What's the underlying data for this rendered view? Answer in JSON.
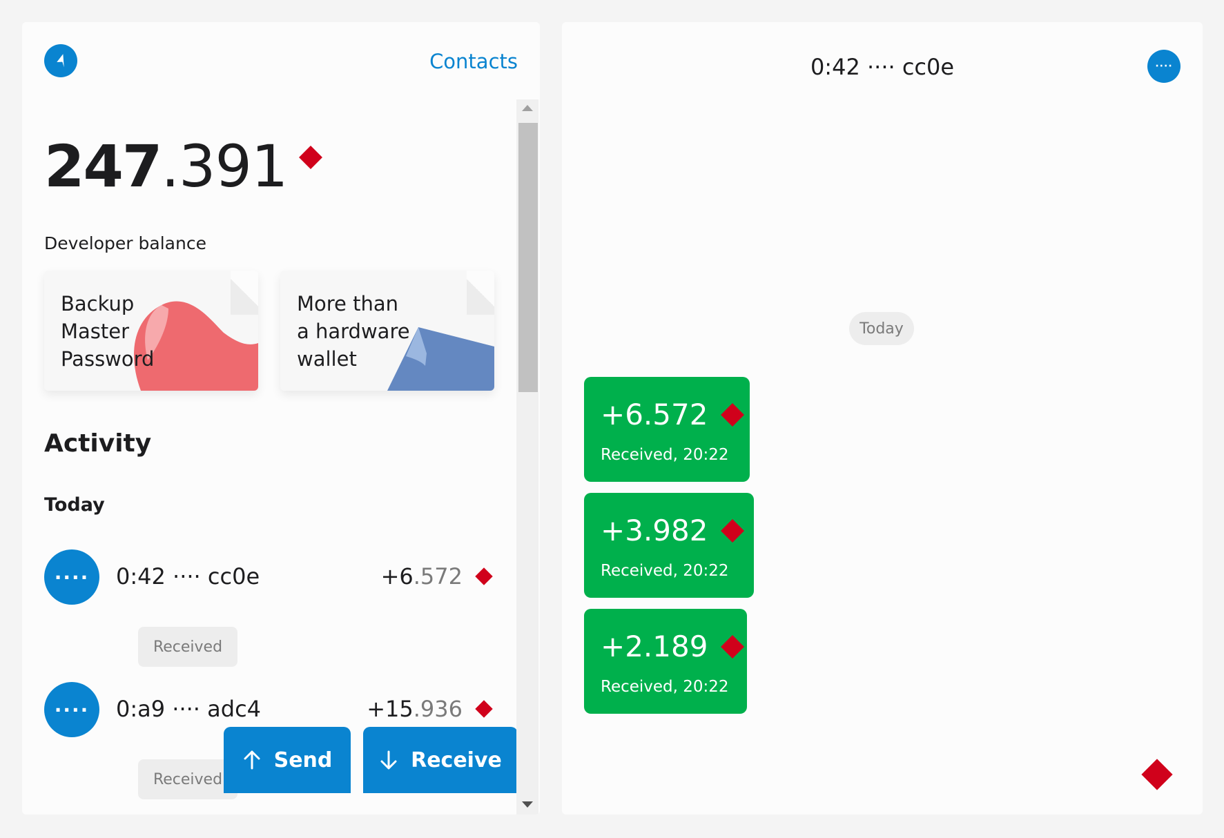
{
  "header": {
    "contacts_label": "Contacts"
  },
  "balance": {
    "integer": "247",
    "fraction": ".391",
    "label": "Developer balance"
  },
  "promos": [
    {
      "title_lines": [
        "Backup",
        "Master",
        "Password"
      ]
    },
    {
      "title_lines": [
        "More than",
        "a hardware",
        "wallet"
      ]
    }
  ],
  "activity": {
    "title": "Activity",
    "day_label": "Today",
    "transactions": [
      {
        "avatar": "····",
        "address": "0:42 ···· cc0e",
        "amount_int": "+6",
        "amount_frac": ".572",
        "status": "Received"
      },
      {
        "avatar": "····",
        "address": "0:a9 ···· adc4",
        "amount_int": "+15",
        "amount_frac": ".936",
        "status": "Received"
      }
    ]
  },
  "actions": {
    "send_label": "Send",
    "receive_label": "Receive"
  },
  "chat": {
    "title": "0:42 ···· cc0e",
    "more_label": "····",
    "day_label": "Today",
    "messages": [
      {
        "amount": "+6.572",
        "subtitle": "Received, 20:22"
      },
      {
        "amount": "+3.982",
        "subtitle": "Received, 20:22"
      },
      {
        "amount": "+2.189",
        "subtitle": "Received, 20:22"
      }
    ]
  },
  "colors": {
    "accent": "#0a84d0",
    "currency_diamond": "#d0011b",
    "received_bubble": "#00b04c",
    "promo_backup": "#ee6a6f",
    "promo_hardware": "#6488c1"
  },
  "icons": {
    "back": "back-arrow-icon",
    "send": "arrow-up-icon",
    "receive": "arrow-down-icon",
    "currency": "diamond-currency-icon",
    "more": "more-dots-icon"
  }
}
